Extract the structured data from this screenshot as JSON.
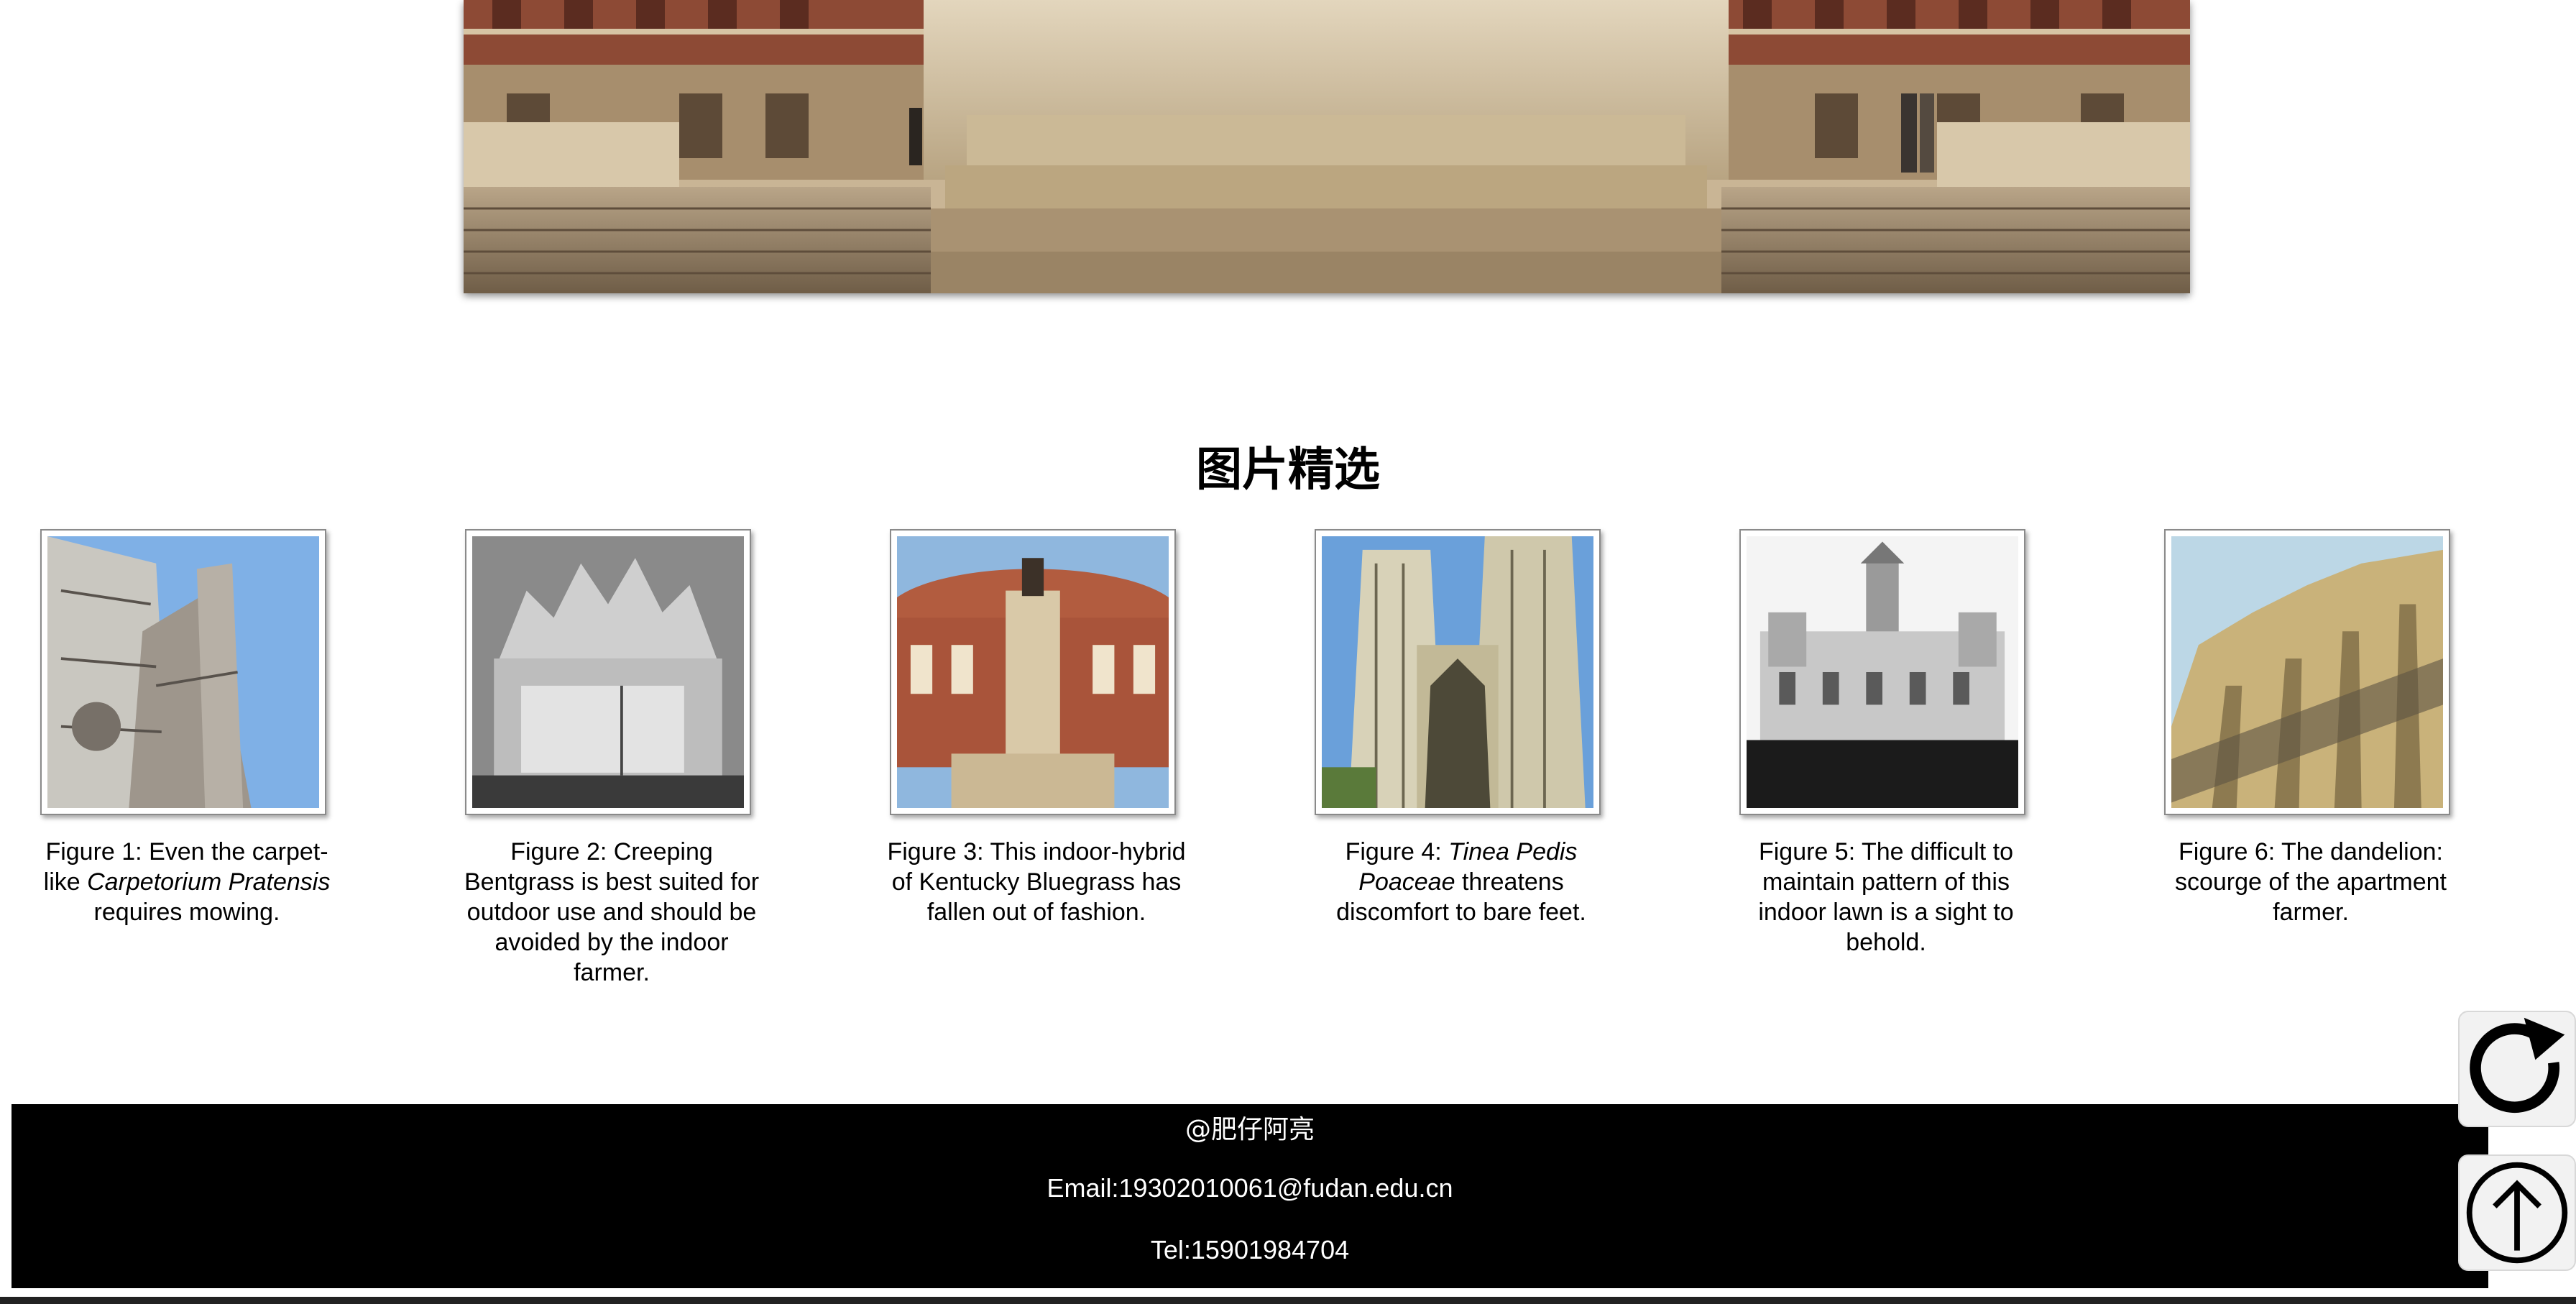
{
  "hero": {
    "image": "royal-albert-hall-steps-photo"
  },
  "gallery": {
    "title": "图片精选",
    "figures": [
      {
        "image": "florence-cathedral-bell-tower-photo",
        "caption_before": "Figure 1: Even the carpet-like ",
        "caption_italic": "Carpetorium Pratensis",
        "caption_after": " requires mowing."
      },
      {
        "image": "milan-cathedral-grayscale-photo",
        "caption_before": "Figure 2: Creeping Bentgrass is best suited for outdoor use and should be avoided by the indoor farmer.",
        "caption_italic": "",
        "caption_after": ""
      },
      {
        "image": "royal-albert-hall-memorial-photo",
        "caption_before": "Figure 3: This indoor-hybrid of Kentucky Bluegrass has fallen out of fashion.",
        "caption_italic": "",
        "caption_after": ""
      },
      {
        "image": "westminster-abbey-photo",
        "caption_before": "Figure 4: ",
        "caption_italic": "Tinea Pedis Poaceae",
        "caption_after": " threatens discomfort to bare feet."
      },
      {
        "image": "madrid-cibeles-palace-photo",
        "caption_before": "Figure 5: The difficult to maintain pattern of this indoor lawn is a sight to behold.",
        "caption_italic": "",
        "caption_after": ""
      },
      {
        "image": "santiago-bernabeu-stadium-photo",
        "caption_before": "Figure 6: The dandelion: scourge of the apartment farmer.",
        "caption_italic": "",
        "caption_after": ""
      }
    ]
  },
  "footer": {
    "author": "@肥仔阿亮",
    "email": "Email:19302010061@fudan.edu.cn",
    "tel": "Tel:15901984704"
  },
  "floating": {
    "refresh_icon": "refresh-icon",
    "top_icon": "arrow-up-circle-icon"
  },
  "colors": {
    "footer_bg": "#000000",
    "footer_text": "#ffffff",
    "frame_border": "#8a8a8a"
  }
}
